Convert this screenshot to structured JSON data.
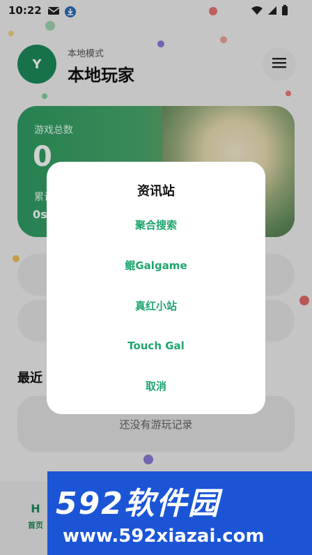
{
  "status_bar": {
    "time": "10:22"
  },
  "header": {
    "avatar_letter": "Y",
    "mode": "本地模式",
    "player_name": "本地玩家"
  },
  "stats": {
    "total_games_label": "游戏总数",
    "total_games": "0",
    "cumulative_label": "累计",
    "cumulative_time": "0s"
  },
  "recent": {
    "title": "最近",
    "empty_text": "还没有游玩记录"
  },
  "bottom_nav": {
    "home_icon": "H",
    "home_label": "首页"
  },
  "dialog": {
    "title": "资讯站",
    "options": [
      "聚合搜索",
      "鲲Galgame",
      "真红小站",
      "Touch Gal",
      "取消"
    ]
  },
  "watermark": {
    "brand": "592软件园",
    "url": "www.592xiazai.com"
  },
  "colors": {
    "accent": "#1fa56e",
    "watermark_blue": "#1b55d6"
  }
}
